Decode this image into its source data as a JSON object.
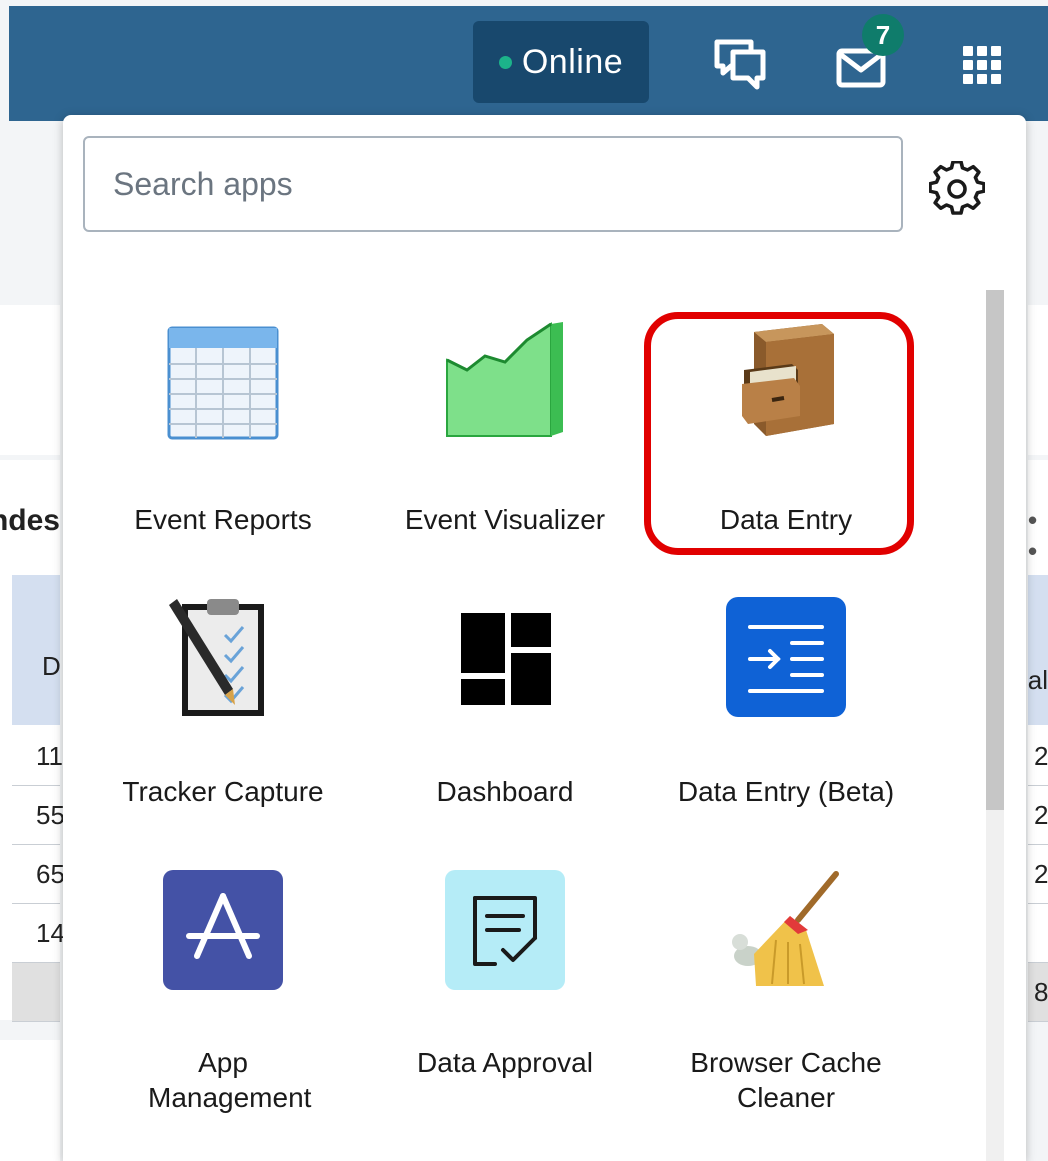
{
  "header": {
    "status_label": "Online",
    "interpretations_icon": "chat-bubbles-icon",
    "messages_icon": "mail-icon",
    "messages_badge": "7",
    "apps_menu_icon": "grid-apps-icon"
  },
  "background_fragments": {
    "heading_partial": "ndes",
    "more_partial": "• •",
    "col_left_header": "D",
    "col_right_header": "tal",
    "left_values": [
      "11",
      "55",
      "65",
      "14"
    ],
    "right_values": [
      "2",
      "2",
      "2",
      "8"
    ]
  },
  "apps_menu": {
    "search_placeholder": "Search apps",
    "settings_icon": "gear-icon",
    "apps": [
      {
        "label": "Event Reports",
        "icon": "table-icon"
      },
      {
        "label": "Event Visualizer",
        "icon": "area-chart-icon"
      },
      {
        "label": "Data Entry",
        "icon": "file-cabinet-icon"
      },
      {
        "label": "Tracker Capture",
        "icon": "clipboard-pen-icon"
      },
      {
        "label": "Dashboard",
        "icon": "dashboard-blocks-icon"
      },
      {
        "label": "Data Entry (Beta)",
        "icon": "indent-list-icon"
      },
      {
        "label": "App Management",
        "icon": "app-store-icon"
      },
      {
        "label": "Data Approval",
        "icon": "document-check-icon"
      },
      {
        "label": "Browser Cache Cleaner",
        "icon": "broom-icon"
      }
    ]
  },
  "colors": {
    "header": "#2e6590",
    "status_pill": "#18486d",
    "online_dot": "#1cb38a",
    "badge": "#0f7c6b",
    "highlight": "#e10000"
  }
}
